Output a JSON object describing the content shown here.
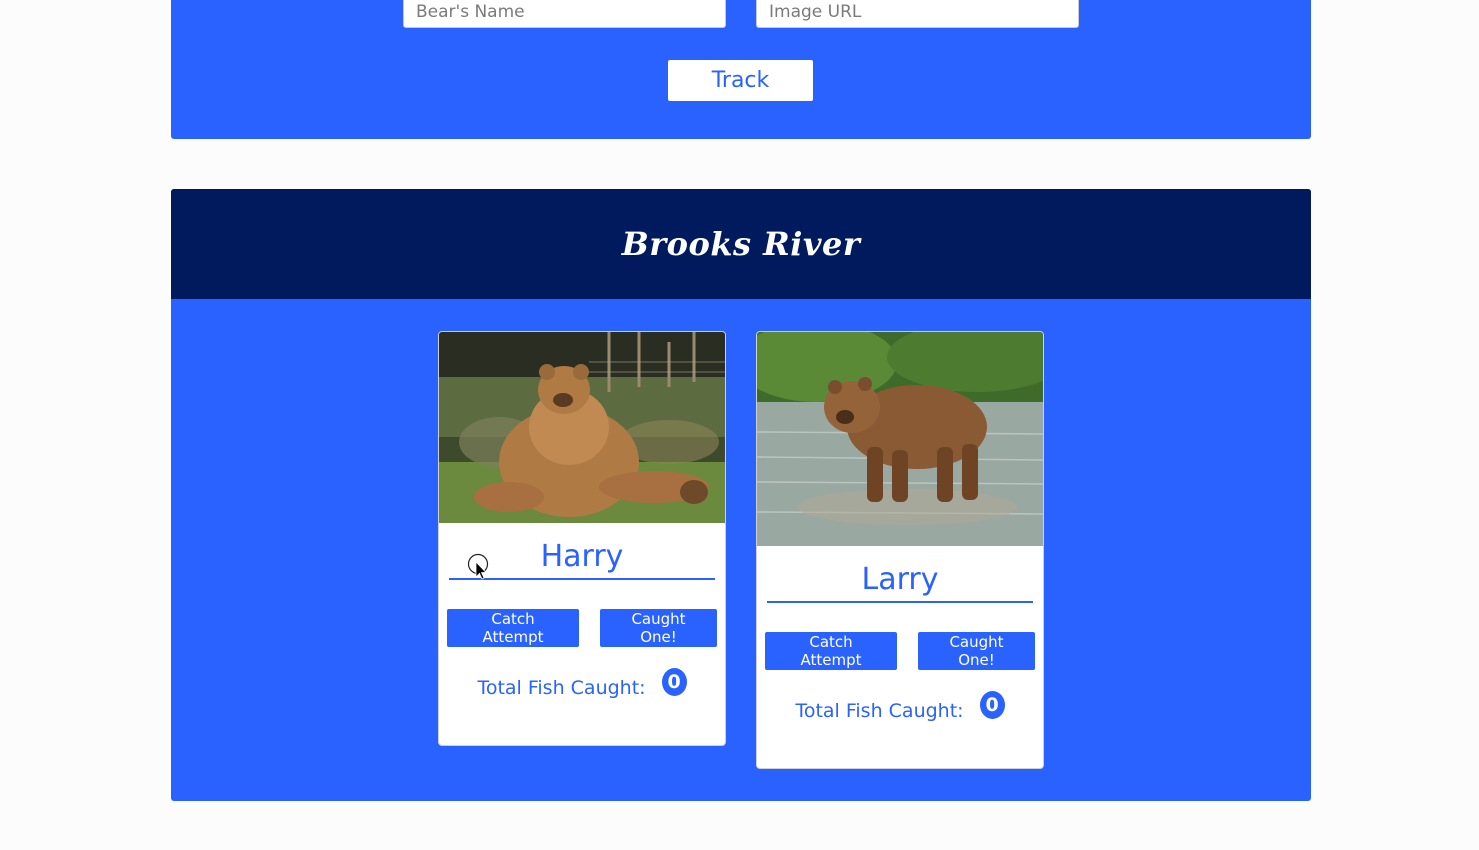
{
  "form": {
    "name_placeholder": "Bear's Name",
    "url_placeholder": "Image URL",
    "track_label": "Track"
  },
  "river": {
    "title": "Brooks River",
    "bears": [
      {
        "name": "Harry",
        "catch_attempt_label": "Catch Attempt",
        "caught_one_label": "Caught One!",
        "total_label": "Total Fish Caught:",
        "total_count": "0"
      },
      {
        "name": "Larry",
        "catch_attempt_label": "Catch Attempt",
        "caught_one_label": "Caught One!",
        "total_label": "Total Fish Caught:",
        "total_count": "0"
      }
    ]
  },
  "colors": {
    "primary_blue": "#2962ff",
    "header_navy": "#001a5e",
    "card_white": "#ffffff"
  }
}
